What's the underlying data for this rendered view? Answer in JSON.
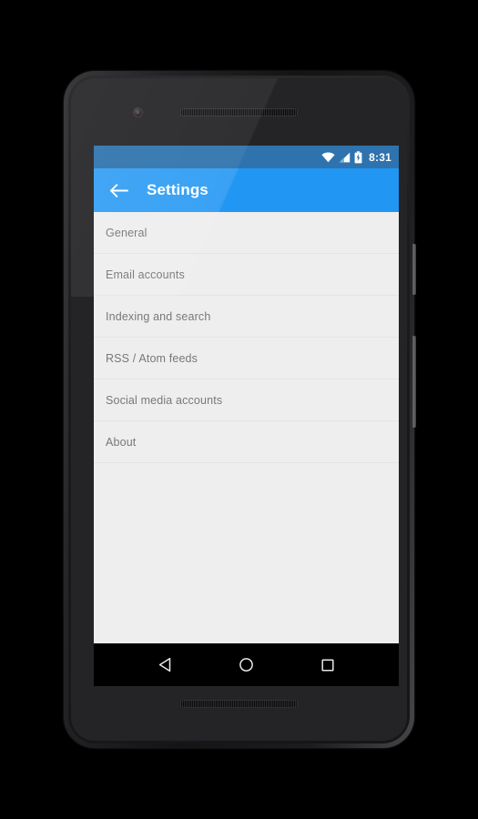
{
  "device": {
    "name": "android-phone",
    "components": {
      "front_camera": "camera-icon",
      "earpiece": "earpiece-speaker",
      "bottom_speaker": "bottom-speaker",
      "power_button": "power-button",
      "volume_button": "volume-rocker-button"
    }
  },
  "status_bar": {
    "time": "8:31",
    "icons": [
      {
        "name": "wifi-icon",
        "label": "Wi-Fi connected"
      },
      {
        "name": "cellular-signal-icon",
        "label": "Cellular signal"
      },
      {
        "name": "battery-charging-icon",
        "label": "Battery charging"
      }
    ],
    "background_color": "#2e73ad",
    "text_color": "#ffffff"
  },
  "app_bar": {
    "title": "Settings",
    "back_icon": "arrow-back-icon",
    "background_color": "#2196f3",
    "text_color": "#ffffff"
  },
  "settings_list": {
    "background_color": "#eeeeee",
    "text_color": "#787878",
    "divider_color": "#e4e4e4",
    "items": [
      {
        "label": "General"
      },
      {
        "label": "Email accounts"
      },
      {
        "label": "Indexing and search"
      },
      {
        "label": "RSS / Atom feeds"
      },
      {
        "label": "Social media accounts"
      },
      {
        "label": "About"
      }
    ]
  },
  "nav_bar": {
    "background_color": "#000000",
    "buttons": [
      {
        "name": "back-nav-button",
        "icon": "triangle-back-icon"
      },
      {
        "name": "home-nav-button",
        "icon": "circle-home-icon"
      },
      {
        "name": "recents-nav-button",
        "icon": "square-recents-icon"
      }
    ]
  }
}
